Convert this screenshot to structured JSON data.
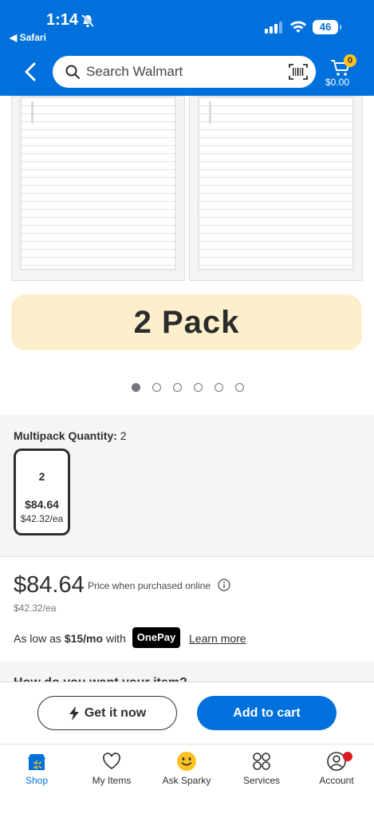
{
  "status": {
    "time": "1:14",
    "back_app": "◀ Safari",
    "battery": "46"
  },
  "header": {
    "search_placeholder": "Search Walmart",
    "cart_count": "0",
    "cart_total": "$0.00"
  },
  "gallery": {
    "banner": "2 Pack",
    "dot_count": 6,
    "active_dot": 0
  },
  "multipack": {
    "label": "Multipack Quantity:",
    "selected_value": "2",
    "option": {
      "count": "2",
      "price": "$84.64",
      "each": "$42.32/ea"
    }
  },
  "pricing": {
    "price": "$84.64",
    "note": "Price when purchased online",
    "each": "$42.32/ea",
    "finance_prefix": "As low as",
    "finance_amount": "$15/mo",
    "finance_suffix": "with",
    "onepay_label": "OnePay",
    "learn_more": "Learn more"
  },
  "fulfillment": {
    "title": "How do you want your item?"
  },
  "actions": {
    "get_it_now": "Get it now",
    "add_to_cart": "Add to cart"
  },
  "tabs": [
    {
      "label": "Shop",
      "icon": "store-icon"
    },
    {
      "label": "My Items",
      "icon": "heart-icon"
    },
    {
      "label": "Ask Sparky",
      "icon": "sparky-icon"
    },
    {
      "label": "Services",
      "icon": "services-icon"
    },
    {
      "label": "Account",
      "icon": "account-icon"
    }
  ],
  "colors": {
    "brand_blue": "#0071dc",
    "spark_yellow": "#ffc220",
    "banner_bg": "#fdefcb",
    "alert_red": "#de1c24"
  }
}
